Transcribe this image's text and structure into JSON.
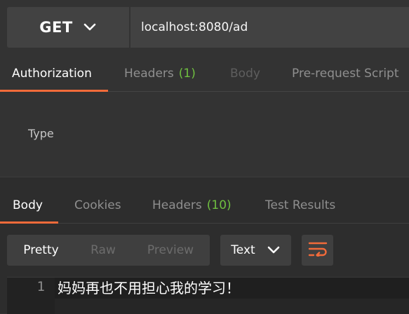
{
  "request": {
    "method": "GET",
    "url": "localhost:8080/ad"
  },
  "request_tabs": [
    {
      "label": "Authorization",
      "active": true
    },
    {
      "label": "Headers",
      "count": "(1)"
    },
    {
      "label": "Body",
      "disabled": true
    },
    {
      "label": "Pre-request Script"
    }
  ],
  "auth": {
    "type_label": "Type"
  },
  "response_tabs": [
    {
      "label": "Body",
      "active": true
    },
    {
      "label": "Cookies"
    },
    {
      "label": "Headers",
      "count": "(10)"
    },
    {
      "label": "Test Results"
    }
  ],
  "response_view": {
    "modes": [
      "Pretty",
      "Raw",
      "Preview"
    ],
    "active_mode": "Pretty",
    "format": "Text",
    "wrap_icon": "wrap-lines-icon"
  },
  "response_body": {
    "lines": [
      {
        "number": "1",
        "text": "妈妈再也不用担心我的学习！"
      }
    ]
  },
  "colors": {
    "accent": "#f26b3a",
    "count": "#6fbf40",
    "background": "#333333",
    "panel": "#424242"
  }
}
